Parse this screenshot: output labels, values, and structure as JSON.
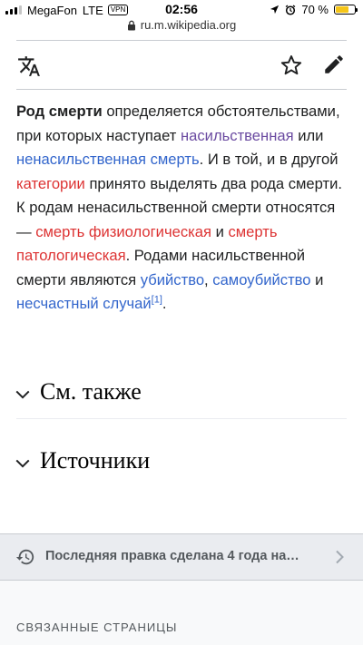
{
  "status_bar": {
    "carrier": "MegaFon",
    "network": "LTE",
    "vpn": "VPN",
    "time": "02:56",
    "battery": "70 %",
    "url": "ru.m.wikipedia.org"
  },
  "icons": {
    "translate": "translate-icon",
    "star": "star-icon",
    "edit": "pencil-icon",
    "history": "history-icon"
  },
  "article": {
    "bold_term": "Род смерти",
    "t1": " определяется обстоятельствами, при которых наступает ",
    "link_violent": "насильственная",
    "t2": " или ",
    "link_nonviolent": "ненасильственная смерть",
    "t3": ". И в той, и в другой ",
    "link_category": "категории",
    "t4": " принято выделять два рода смерти. К родам ненасильственной смерти относятся — ",
    "link_physio": "смерть физиологическая",
    "t5": " и ",
    "link_patho": "смерть патологическая",
    "t6": ". Родами насильственной смерти являются ",
    "link_murder": "убийство",
    "t7": ", ",
    "link_suicide": "самоубийство",
    "t8": " и ",
    "link_accident": "несчастный случай",
    "ref": "[1]",
    "t9": "."
  },
  "sections": {
    "see_also": "См. также",
    "sources": "Источники"
  },
  "last_edit": {
    "text": "Последняя правка сделана 4 года на…"
  },
  "related": {
    "title": "СВЯЗАННЫЕ СТРАНИЦЫ"
  },
  "colors": {
    "visited_link": "#6b4ba1",
    "link": "#3366cc",
    "red_link": "#d33",
    "battery": "#f5c518"
  }
}
